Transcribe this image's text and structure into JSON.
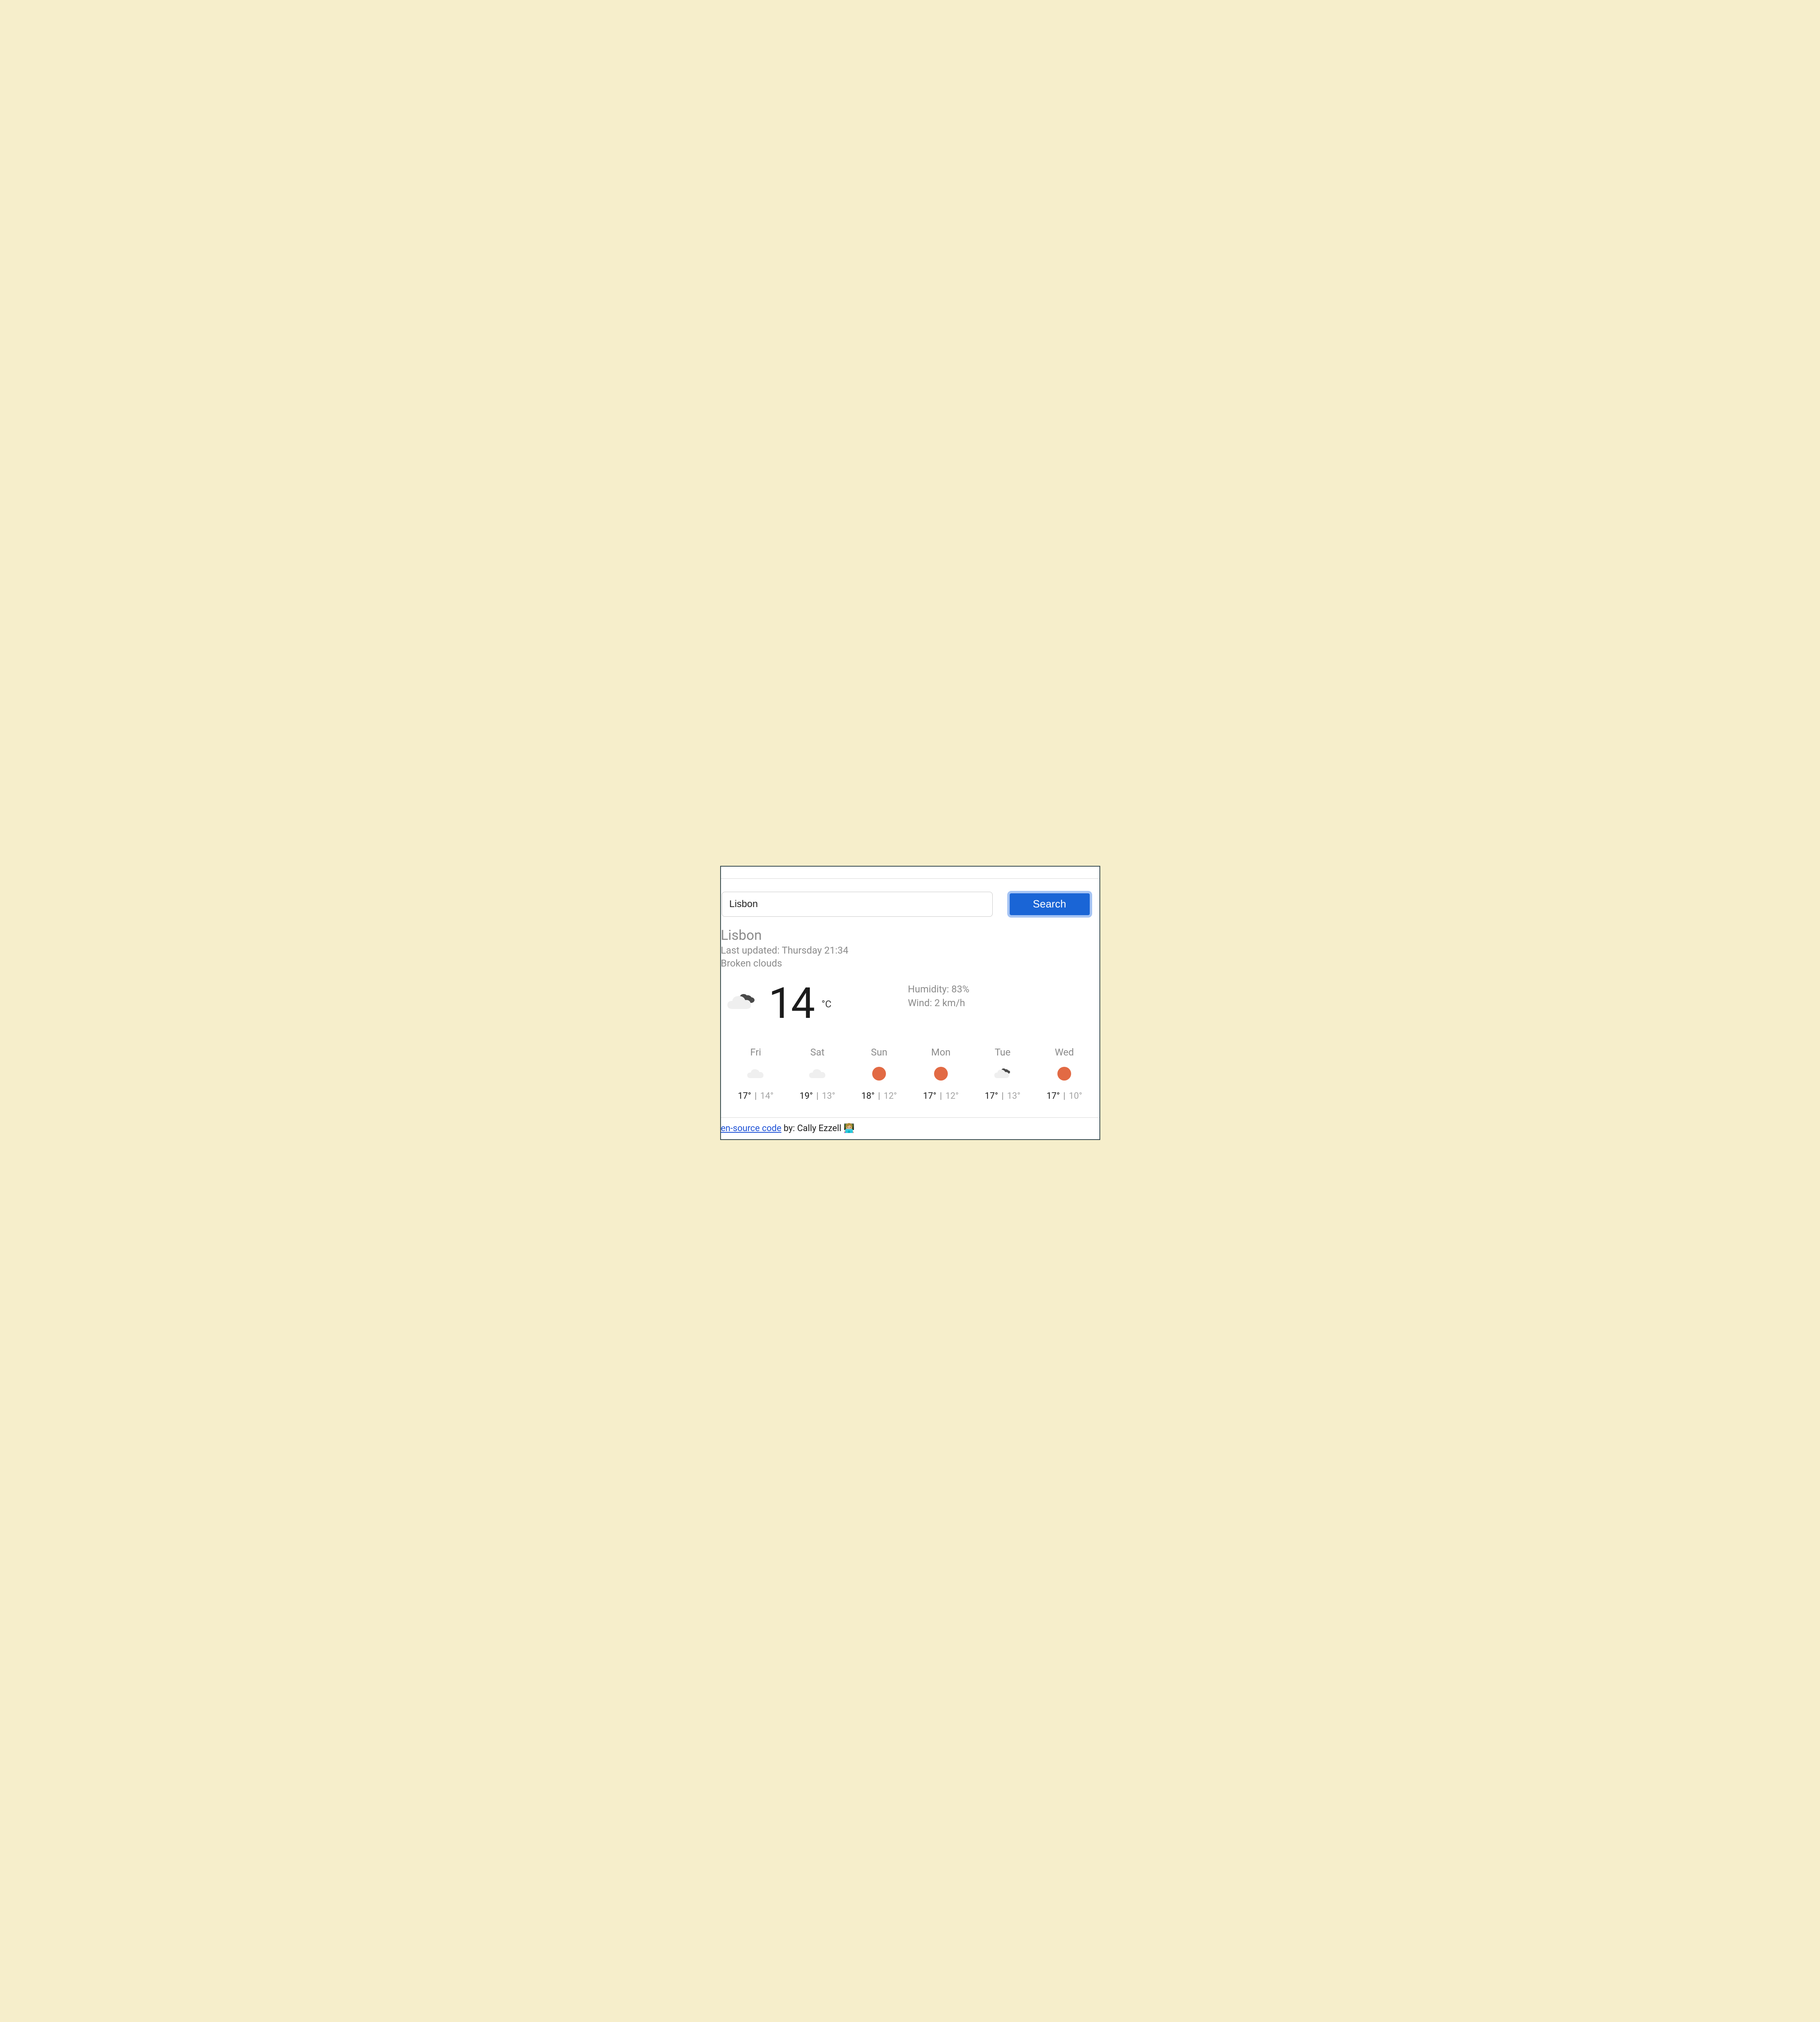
{
  "search": {
    "value": "Lisbon",
    "button": "Search"
  },
  "location": {
    "city": "Lisbon",
    "updated_label": "Last updated: Thursday 21:34",
    "conditions": "Broken clouds"
  },
  "current": {
    "temp": "14",
    "unit": "°C",
    "humidity_label": "Humidity: 83%",
    "wind_label": "Wind: 2 km/h",
    "icon": "broken-clouds"
  },
  "forecast": [
    {
      "day": "Fri",
      "icon": "cloud",
      "hi": "17°",
      "lo": "14°"
    },
    {
      "day": "Sat",
      "icon": "cloud",
      "hi": "19°",
      "lo": "13°"
    },
    {
      "day": "Sun",
      "icon": "sun",
      "hi": "18°",
      "lo": "12°"
    },
    {
      "day": "Mon",
      "icon": "sun",
      "hi": "17°",
      "lo": "12°"
    },
    {
      "day": "Tue",
      "icon": "broken-clouds",
      "hi": "17°",
      "lo": "13°"
    },
    {
      "day": "Wed",
      "icon": "sun",
      "hi": "17°",
      "lo": "10°"
    }
  ],
  "footer": {
    "link_text": "en-source code",
    "by_text": " by: Cally Ezzell ",
    "emoji": "👩🏼‍💻"
  }
}
